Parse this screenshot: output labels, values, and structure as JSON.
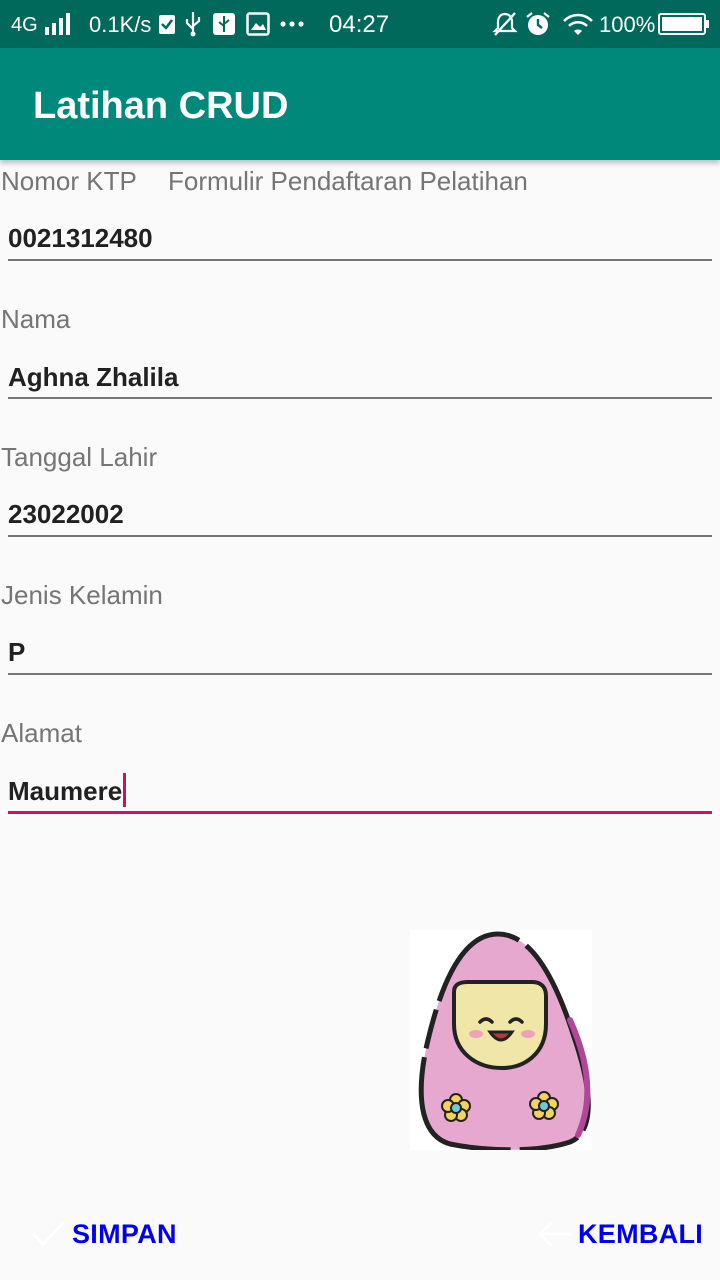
{
  "status_bar": {
    "network": "4G",
    "speed": "0.1K/s",
    "time": "04:27",
    "battery": "100%",
    "icons": [
      "signal-icon",
      "download-check-icon",
      "usb-icon",
      "usb-debug-icon",
      "image-icon",
      "more-dots-icon",
      "mute-icon",
      "alarm-icon",
      "wifi-icon",
      "battery-icon"
    ]
  },
  "app_bar": {
    "title": "Latihan CRUD"
  },
  "form": {
    "title": "Formulir Pendaftaran Pelatihan",
    "fields": [
      {
        "label": "Nomor KTP",
        "value": "0021312480"
      },
      {
        "label": "Nama",
        "value": "Aghna Zhalila"
      },
      {
        "label": "Tanggal Lahir",
        "value": "23022002"
      },
      {
        "label": "Jenis Kelamin",
        "value": "P"
      },
      {
        "label": "Alamat",
        "value": "Maumere"
      }
    ]
  },
  "image": {
    "name": "girl-hijab-illustration"
  },
  "actions": {
    "save_label": "SIMPAN",
    "back_label": "KEMBALI",
    "save_icon": "check-icon",
    "back_icon": "arrow-left-icon"
  },
  "colors": {
    "status_bar": "#00695c",
    "app_bar": "#00897b",
    "accent": "#c2185b",
    "button_text": "#0000ee"
  }
}
